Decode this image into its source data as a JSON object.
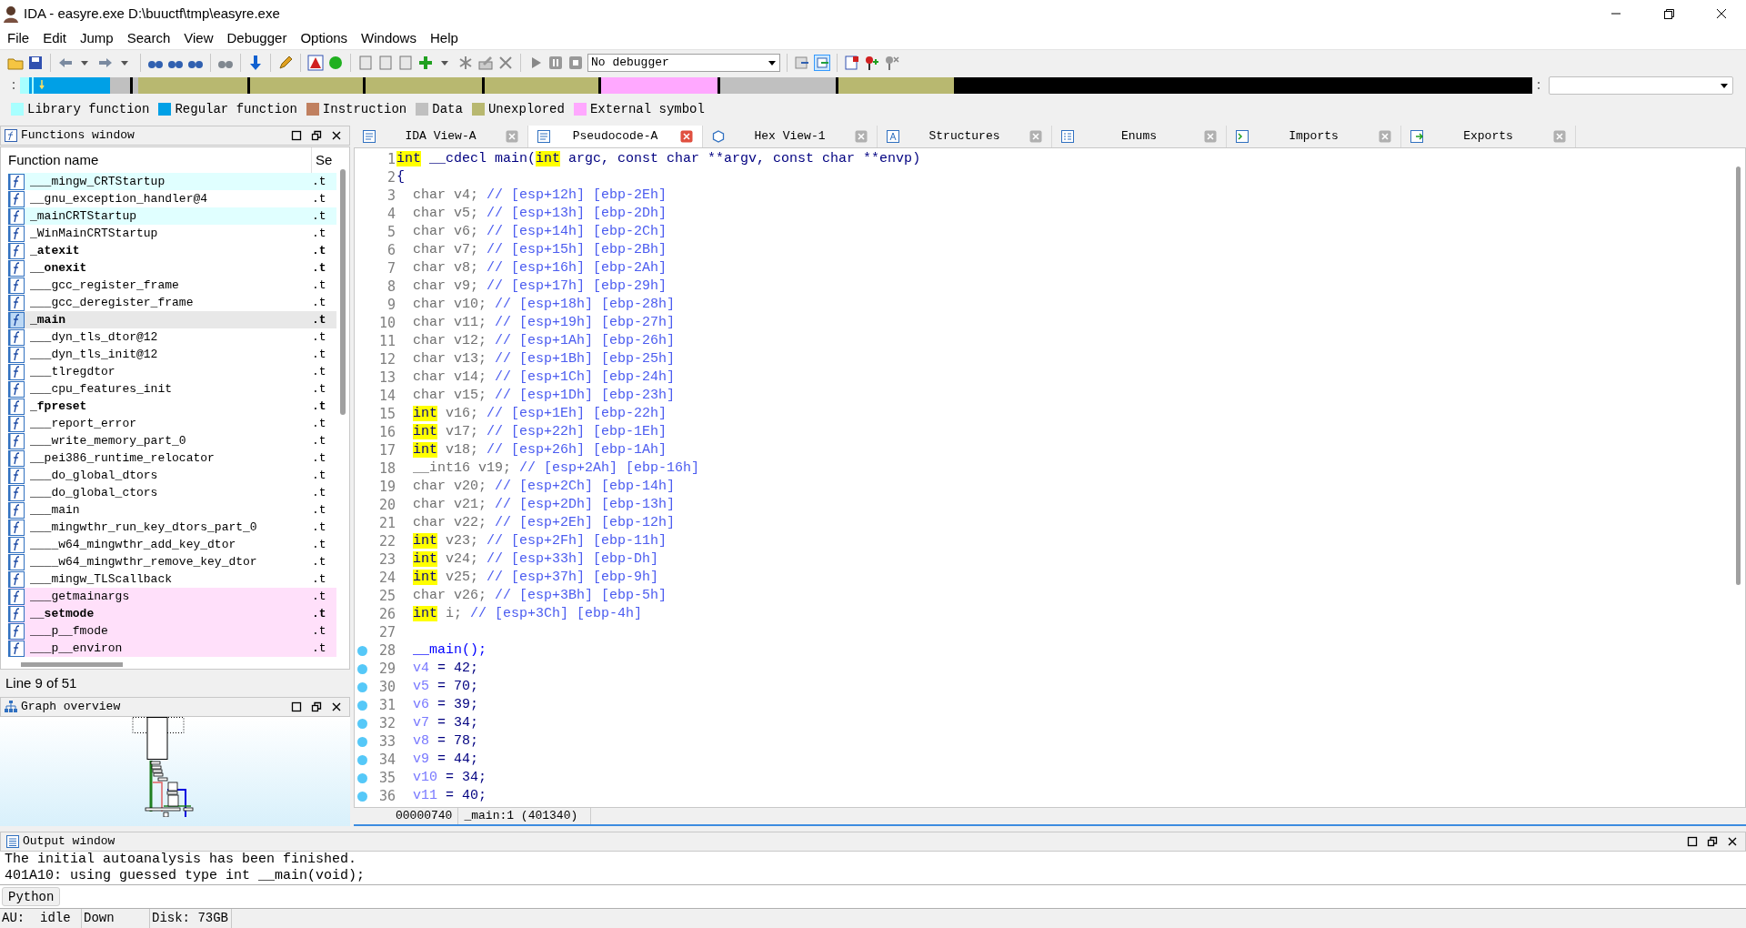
{
  "window": {
    "title": "IDA - easyre.exe D:\\buuctf\\tmp\\easyre.exe"
  },
  "menu": [
    "File",
    "Edit",
    "Jump",
    "Search",
    "View",
    "Debugger",
    "Options",
    "Windows",
    "Help"
  ],
  "toolbar": {
    "debugger": "No debugger"
  },
  "legend": [
    {
      "label": "Library function",
      "color": "#a8ffff"
    },
    {
      "label": "Regular function",
      "color": "#00a0e6"
    },
    {
      "label": "Instruction",
      "color": "#c08060"
    },
    {
      "label": "Data",
      "color": "#c0c0c0"
    },
    {
      "label": "Unexplored",
      "color": "#b8b870"
    },
    {
      "label": "External symbol",
      "color": "#ffa8ff"
    }
  ],
  "functions_window": {
    "title": "Functions window",
    "columns": [
      "Function name",
      "Se"
    ],
    "rows": [
      {
        "name": "___mingw_CRTStartup",
        "segment": ".t",
        "kind": "library",
        "bold": false,
        "selected": false
      },
      {
        "name": "__gnu_exception_handler@4",
        "segment": ".t",
        "kind": "regular",
        "bold": false,
        "selected": false
      },
      {
        "name": "_mainCRTStartup",
        "segment": ".t",
        "kind": "library",
        "bold": false,
        "selected": false
      },
      {
        "name": "_WinMainCRTStartup",
        "segment": ".t",
        "kind": "regular",
        "bold": false,
        "selected": false
      },
      {
        "name": "_atexit",
        "segment": ".t",
        "kind": "regular",
        "bold": true,
        "selected": false
      },
      {
        "name": "__onexit",
        "segment": ".t",
        "kind": "regular",
        "bold": true,
        "selected": false
      },
      {
        "name": "___gcc_register_frame",
        "segment": ".t",
        "kind": "regular",
        "bold": false,
        "selected": false
      },
      {
        "name": "___gcc_deregister_frame",
        "segment": ".t",
        "kind": "regular",
        "bold": false,
        "selected": false
      },
      {
        "name": "_main",
        "segment": ".t",
        "kind": "regular",
        "bold": true,
        "selected": true
      },
      {
        "name": "___dyn_tls_dtor@12",
        "segment": ".t",
        "kind": "regular",
        "bold": false,
        "selected": false
      },
      {
        "name": "___dyn_tls_init@12",
        "segment": ".t",
        "kind": "regular",
        "bold": false,
        "selected": false
      },
      {
        "name": "___tlregdtor",
        "segment": ".t",
        "kind": "regular",
        "bold": false,
        "selected": false
      },
      {
        "name": "___cpu_features_init",
        "segment": ".t",
        "kind": "regular",
        "bold": false,
        "selected": false
      },
      {
        "name": "_fpreset",
        "segment": ".t",
        "kind": "regular",
        "bold": true,
        "selected": false
      },
      {
        "name": "___report_error",
        "segment": ".t",
        "kind": "regular",
        "bold": false,
        "selected": false
      },
      {
        "name": "___write_memory_part_0",
        "segment": ".t",
        "kind": "regular",
        "bold": false,
        "selected": false
      },
      {
        "name": "__pei386_runtime_relocator",
        "segment": ".t",
        "kind": "regular",
        "bold": false,
        "selected": false
      },
      {
        "name": "___do_global_dtors",
        "segment": ".t",
        "kind": "regular",
        "bold": false,
        "selected": false
      },
      {
        "name": "___do_global_ctors",
        "segment": ".t",
        "kind": "regular",
        "bold": false,
        "selected": false
      },
      {
        "name": "___main",
        "segment": ".t",
        "kind": "regular",
        "bold": false,
        "selected": false
      },
      {
        "name": "___mingwthr_run_key_dtors_part_0",
        "segment": ".t",
        "kind": "regular",
        "bold": false,
        "selected": false
      },
      {
        "name": "____w64_mingwthr_add_key_dtor",
        "segment": ".t",
        "kind": "regular",
        "bold": false,
        "selected": false
      },
      {
        "name": "____w64_mingwthr_remove_key_dtor",
        "segment": ".t",
        "kind": "regular",
        "bold": false,
        "selected": false
      },
      {
        "name": "___mingw_TLScallback",
        "segment": ".t",
        "kind": "regular",
        "bold": false,
        "selected": false
      },
      {
        "name": "___getmainargs",
        "segment": ".t",
        "kind": "external",
        "bold": false,
        "selected": false
      },
      {
        "name": "__setmode",
        "segment": ".t",
        "kind": "external",
        "bold": true,
        "selected": false
      },
      {
        "name": "___p__fmode",
        "segment": ".t",
        "kind": "external",
        "bold": false,
        "selected": false
      },
      {
        "name": "___p__environ",
        "segment": ".t",
        "kind": "external",
        "bold": false,
        "selected": false
      }
    ],
    "line_info": "Line 9 of 51"
  },
  "graph_overview": {
    "title": "Graph overview"
  },
  "tabs": [
    {
      "label": "IDA View-A",
      "selected": false
    },
    {
      "label": "Pseudocode-A",
      "selected": true
    },
    {
      "label": "Hex View-1",
      "selected": false
    },
    {
      "label": "Structures",
      "selected": false
    },
    {
      "label": "Enums",
      "selected": false
    },
    {
      "label": "Imports",
      "selected": false
    },
    {
      "label": "Exports",
      "selected": false
    }
  ],
  "code": [
    {
      "n": "1",
      "breakpoint": false,
      "segs": [
        {
          "kind": "type_hl",
          "text": "int"
        },
        {
          "kind": "text",
          "text": " __cdecl main("
        },
        {
          "kind": "type_hl",
          "text": "int"
        },
        {
          "kind": "text",
          "text": " argc, const char **argv, const char **envp)"
        }
      ]
    },
    {
      "n": "2",
      "breakpoint": false,
      "segs": [
        {
          "kind": "text",
          "text": "{"
        }
      ],
      "children": [
        {
          "n": "3",
          "breakpoint": false,
          "segs": [
            {
              "kind": "decl",
              "text": "char v4; "
            },
            {
              "kind": "comment",
              "text": "// [esp+12h] [ebp-2Eh]"
            }
          ]
        },
        {
          "n": "4",
          "breakpoint": false,
          "segs": [
            {
              "kind": "decl",
              "text": "char v5; "
            },
            {
              "kind": "comment",
              "text": "// [esp+13h] [ebp-2Dh]"
            }
          ]
        },
        {
          "n": "5",
          "breakpoint": false,
          "segs": [
            {
              "kind": "decl",
              "text": "char v6; "
            },
            {
              "kind": "comment",
              "text": "// [esp+14h] [ebp-2Ch]"
            }
          ]
        },
        {
          "n": "6",
          "breakpoint": false,
          "segs": [
            {
              "kind": "decl",
              "text": "char v7; "
            },
            {
              "kind": "comment",
              "text": "// [esp+15h] [ebp-2Bh]"
            }
          ]
        },
        {
          "n": "7",
          "breakpoint": false,
          "segs": [
            {
              "kind": "decl",
              "text": "char v8; "
            },
            {
              "kind": "comment",
              "text": "// [esp+16h] [ebp-2Ah]"
            }
          ]
        },
        {
          "n": "8",
          "breakpoint": false,
          "segs": [
            {
              "kind": "decl",
              "text": "char v9; "
            },
            {
              "kind": "comment",
              "text": "// [esp+17h] [ebp-29h]"
            }
          ]
        },
        {
          "n": "9",
          "breakpoint": false,
          "segs": [
            {
              "kind": "decl",
              "text": "char v10; "
            },
            {
              "kind": "comment",
              "text": "// [esp+18h] [ebp-28h]"
            }
          ]
        },
        {
          "n": "10",
          "breakpoint": false,
          "segs": [
            {
              "kind": "decl",
              "text": "char v11; "
            },
            {
              "kind": "comment",
              "text": "// [esp+19h] [ebp-27h]"
            }
          ]
        },
        {
          "n": "11",
          "breakpoint": false,
          "segs": [
            {
              "kind": "decl",
              "text": "char v12; "
            },
            {
              "kind": "comment",
              "text": "// [esp+1Ah] [ebp-26h]"
            }
          ]
        },
        {
          "n": "12",
          "breakpoint": false,
          "segs": [
            {
              "kind": "decl",
              "text": "char v13; "
            },
            {
              "kind": "comment",
              "text": "// [esp+1Bh] [ebp-25h]"
            }
          ]
        },
        {
          "n": "13",
          "breakpoint": false,
          "segs": [
            {
              "kind": "decl",
              "text": "char v14; "
            },
            {
              "kind": "comment",
              "text": "// [esp+1Ch] [ebp-24h]"
            }
          ]
        },
        {
          "n": "14",
          "breakpoint": false,
          "segs": [
            {
              "kind": "decl",
              "text": "char v15; "
            },
            {
              "kind": "comment",
              "text": "// [esp+1Dh] [ebp-23h]"
            }
          ]
        },
        {
          "n": "15",
          "breakpoint": false,
          "segs": [
            {
              "kind": "type_hl",
              "text": "int"
            },
            {
              "kind": "decl",
              "text": " v16; "
            },
            {
              "kind": "comment",
              "text": "// [esp+1Eh] [ebp-22h]"
            }
          ]
        },
        {
          "n": "16",
          "breakpoint": false,
          "segs": [
            {
              "kind": "type_hl",
              "text": "int"
            },
            {
              "kind": "decl",
              "text": " v17; "
            },
            {
              "kind": "comment",
              "text": "// [esp+22h] [ebp-1Eh]"
            }
          ]
        },
        {
          "n": "17",
          "breakpoint": false,
          "segs": [
            {
              "kind": "type_hl",
              "text": "int"
            },
            {
              "kind": "decl",
              "text": " v18; "
            },
            {
              "kind": "comment",
              "text": "// [esp+26h] [ebp-1Ah]"
            }
          ]
        },
        {
          "n": "18",
          "breakpoint": false,
          "segs": [
            {
              "kind": "decl",
              "text": "__int16 v19; "
            },
            {
              "kind": "comment",
              "text": "// [esp+2Ah] [ebp-16h]"
            }
          ]
        },
        {
          "n": "19",
          "breakpoint": false,
          "segs": [
            {
              "kind": "decl",
              "text": "char v20; "
            },
            {
              "kind": "comment",
              "text": "// [esp+2Ch] [ebp-14h]"
            }
          ]
        },
        {
          "n": "20",
          "breakpoint": false,
          "segs": [
            {
              "kind": "decl",
              "text": "char v21; "
            },
            {
              "kind": "comment",
              "text": "// [esp+2Dh] [ebp-13h]"
            }
          ]
        },
        {
          "n": "21",
          "breakpoint": false,
          "segs": [
            {
              "kind": "decl",
              "text": "char v22; "
            },
            {
              "kind": "comment",
              "text": "// [esp+2Eh] [ebp-12h]"
            }
          ]
        },
        {
          "n": "22",
          "breakpoint": false,
          "segs": [
            {
              "kind": "type_hl",
              "text": "int"
            },
            {
              "kind": "decl",
              "text": " v23; "
            },
            {
              "kind": "comment",
              "text": "// [esp+2Fh] [ebp-11h]"
            }
          ]
        },
        {
          "n": "23",
          "breakpoint": false,
          "segs": [
            {
              "kind": "type_hl",
              "text": "int"
            },
            {
              "kind": "decl",
              "text": " v24; "
            },
            {
              "kind": "comment",
              "text": "// [esp+33h] [ebp-Dh]"
            }
          ]
        },
        {
          "n": "24",
          "breakpoint": false,
          "segs": [
            {
              "kind": "type_hl",
              "text": "int"
            },
            {
              "kind": "decl",
              "text": " v25; "
            },
            {
              "kind": "comment",
              "text": "// [esp+37h] [ebp-9h]"
            }
          ]
        },
        {
          "n": "25",
          "breakpoint": false,
          "segs": [
            {
              "kind": "decl",
              "text": "char v26; "
            },
            {
              "kind": "comment",
              "text": "// [esp+3Bh] [ebp-5h]"
            }
          ]
        },
        {
          "n": "26",
          "breakpoint": false,
          "segs": [
            {
              "kind": "type_hl",
              "text": "int"
            },
            {
              "kind": "decl",
              "text": " i; "
            },
            {
              "kind": "comment",
              "text": "// [esp+3Ch] [ebp-4h]"
            }
          ]
        },
        {
          "n": "27",
          "breakpoint": false
        },
        {
          "n": "28",
          "breakpoint": true,
          "segs": [
            {
              "kind": "call",
              "text": "__main();"
            }
          ]
        },
        {
          "n": "29",
          "breakpoint": true,
          "segs": [
            {
              "kind": "var",
              "text": "v4"
            },
            {
              "kind": "text",
              "text": " = 42;"
            }
          ]
        },
        {
          "n": "30",
          "breakpoint": true,
          "segs": [
            {
              "kind": "var",
              "text": "v5"
            },
            {
              "kind": "text",
              "text": " = 70;"
            }
          ]
        },
        {
          "n": "31",
          "breakpoint": true,
          "segs": [
            {
              "kind": "var",
              "text": "v6"
            },
            {
              "kind": "text",
              "text": " = 39;"
            }
          ]
        },
        {
          "n": "32",
          "breakpoint": true,
          "segs": [
            {
              "kind": "var",
              "text": "v7"
            },
            {
              "kind": "text",
              "text": " = 34;"
            }
          ]
        },
        {
          "n": "33",
          "breakpoint": true,
          "segs": [
            {
              "kind": "var",
              "text": "v8"
            },
            {
              "kind": "text",
              "text": " = 78;"
            }
          ]
        },
        {
          "n": "34",
          "breakpoint": true,
          "segs": [
            {
              "kind": "var",
              "text": "v9"
            },
            {
              "kind": "text",
              "text": " = 44;"
            }
          ]
        },
        {
          "n": "35",
          "breakpoint": true,
          "segs": [
            {
              "kind": "var",
              "text": "v10"
            },
            {
              "kind": "text",
              "text": " = 34;"
            }
          ]
        },
        {
          "n": "36",
          "breakpoint": true,
          "segs": [
            {
              "kind": "var",
              "text": "v11"
            },
            {
              "kind": "text",
              "text": " = 40;"
            }
          ]
        }
      ]
    }
  ],
  "code_status": [
    "00000740",
    "_main:1 (401340)"
  ],
  "output_window": {
    "title": "Output window",
    "lines": [
      "The initial autoanalysis has been finished.",
      "401A10: using guessed type int __main(void);"
    ],
    "language": "Python"
  },
  "status_bar": [
    "AU:  idle",
    "Down",
    "Disk: 73GB"
  ]
}
